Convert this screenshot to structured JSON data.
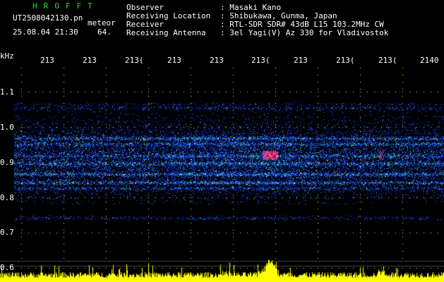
{
  "header": {
    "app_title": "HROFFT",
    "filename": "UT2508042130.pn",
    "mode": "meteor",
    "datetime": "25.08.04 21:30",
    "channel": "64.",
    "labels": [
      "Observer",
      "Receiving Location",
      "Receiver",
      "Receiving Antenna"
    ],
    "values": [
      ": Masaki Kano",
      ": Shibukawa, Gunma, Japan",
      ": RTL-SDR SDR# 43dB L15 103.2MHz CW",
      ": 3el Yagi(V) Az 330 for Vladivostok"
    ]
  },
  "y_axis": {
    "unit": "kHz",
    "ticks": [
      "1.1",
      "1.0",
      "0.9",
      "0.8",
      "0.7",
      "0.6"
    ]
  },
  "x_axis": {
    "ticks": [
      "213",
      "213",
      "213(",
      "213",
      "213",
      "213(",
      "213",
      "213(",
      "213(",
      "2140"
    ]
  },
  "colors": {
    "background": "#000000",
    "title_green": "#22dd22",
    "grid_dots": "#ffff00",
    "echo_noise": "#2244ff",
    "echo_strong": "#ff2266",
    "signal_level": "#ffff00"
  }
}
